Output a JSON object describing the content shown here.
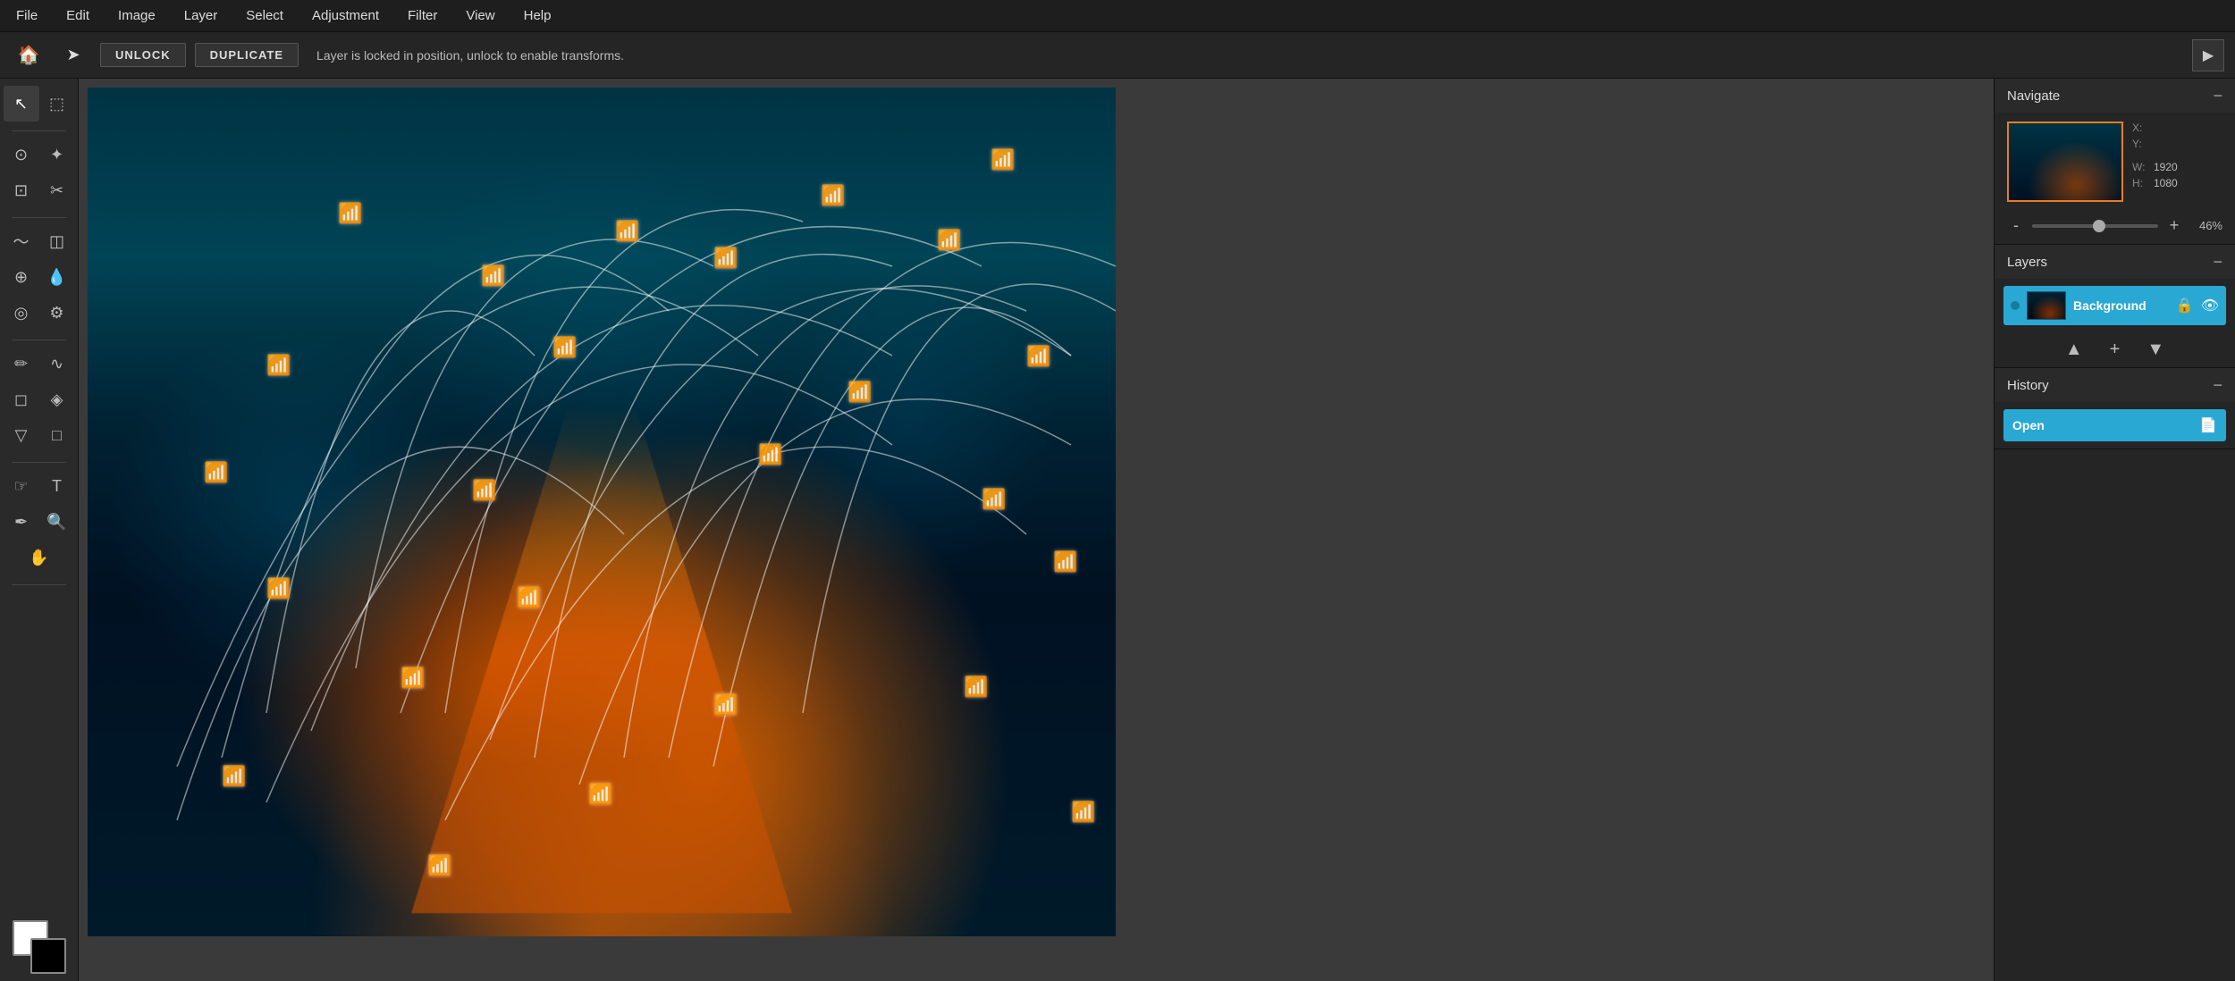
{
  "menubar": {
    "items": [
      "File",
      "Edit",
      "Image",
      "Layer",
      "Select",
      "Adjustment",
      "Filter",
      "View",
      "Help"
    ]
  },
  "toolbar": {
    "unlock_label": "UNLOCK",
    "duplicate_label": "DUPLICATE",
    "message": "Layer is locked in position, unlock to enable transforms."
  },
  "tools": [
    {
      "name": "select",
      "icon": "↖",
      "active": true
    },
    {
      "name": "marquee",
      "icon": "⬚"
    },
    {
      "name": "lasso",
      "icon": "⊙"
    },
    {
      "name": "magic-wand",
      "icon": "✦"
    },
    {
      "name": "crop",
      "icon": "⊡"
    },
    {
      "name": "scissors",
      "icon": "✂"
    },
    {
      "name": "smudge",
      "icon": "〜"
    },
    {
      "name": "eraser-alt",
      "icon": "◫"
    },
    {
      "name": "stamp",
      "icon": "⊕"
    },
    {
      "name": "dropper",
      "icon": "💧"
    },
    {
      "name": "heal",
      "icon": "◎"
    },
    {
      "name": "gear",
      "icon": "⚙"
    },
    {
      "name": "pen",
      "icon": "✏"
    },
    {
      "name": "blur",
      "icon": "∿"
    },
    {
      "name": "eraser",
      "icon": "◻"
    },
    {
      "name": "blur2",
      "icon": "◈"
    },
    {
      "name": "fill",
      "icon": "▽"
    },
    {
      "name": "shape",
      "icon": "□"
    },
    {
      "name": "hand2",
      "icon": "☞"
    },
    {
      "name": "text",
      "icon": "T"
    },
    {
      "name": "brush",
      "icon": "✒"
    },
    {
      "name": "zoom",
      "icon": "🔍"
    },
    {
      "name": "hand",
      "icon": "✋"
    }
  ],
  "navigate": {
    "title": "Navigate",
    "x_label": "X:",
    "y_label": "Y:",
    "x_value": "",
    "y_value": "",
    "w_label": "W:",
    "w_value": "1920",
    "h_label": "H:",
    "h_value": "1080",
    "zoom_value": "46%",
    "zoom_min": "-",
    "zoom_max": "+"
  },
  "layers": {
    "title": "Layers",
    "items": [
      {
        "name": "Background",
        "locked": true,
        "visible": true
      }
    ]
  },
  "history": {
    "title": "History",
    "items": [
      {
        "label": "Open",
        "icon": "📄"
      }
    ]
  },
  "colors": {
    "accent": "#29a8d4",
    "bg_dark": "#1e1e1e",
    "panel_bg": "#252525",
    "layer_active": "#29a8d4"
  }
}
